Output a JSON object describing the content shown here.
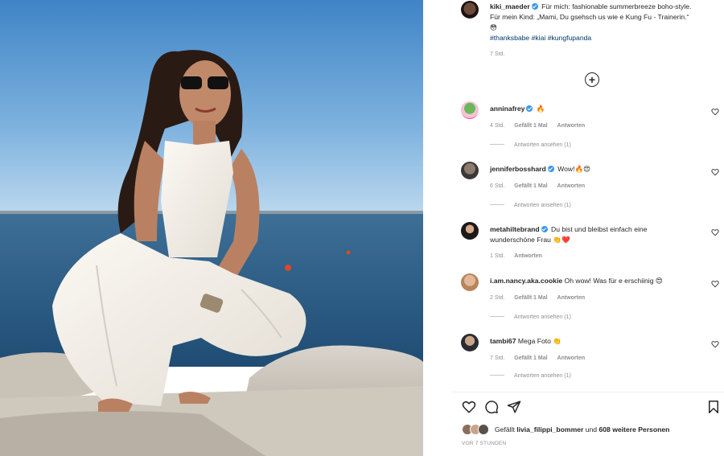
{
  "post": {
    "author": "kiki_maeder",
    "caption_line1": "Für mich: fashionable summerbreeze boho-style.",
    "caption_line2": "Für mein Kind: „Mami, Du gsehsch us wie e Kung Fu - Trainerin.“",
    "caption_emoji": "😳",
    "hashtags": [
      "#thanksbabe",
      "#kiai",
      "#kungfupanda"
    ],
    "time": "7 Std.",
    "verified": true
  },
  "comments": [
    {
      "user": "anninafrey",
      "verified": true,
      "text": "🔥",
      "time": "4 Std.",
      "likes": "Gefällt 1 Mal",
      "reply": "Antworten",
      "replies": "Antworten ansehen (1)"
    },
    {
      "user": "jenniferbosshard",
      "verified": true,
      "text": "Wow!🔥😍",
      "time": "6 Std.",
      "likes": "Gefällt 1 Mal",
      "reply": "Antworten",
      "replies": "Antworten ansehen (1)"
    },
    {
      "user": "metahiltebrand",
      "verified": true,
      "text": "Du bist und bleibst einfach eine wunderschöne Frau 👏❤️",
      "time": "1 Std.",
      "likes": "",
      "reply": "Antworten",
      "replies": ""
    },
    {
      "user": "i.am.nancy.aka.cookie",
      "verified": false,
      "text": "Oh wow! Was für e erschiinig 😍",
      "time": "2 Std.",
      "likes": "Gefällt 1 Mal",
      "reply": "Antworten",
      "replies": "Antworten ansehen (1)"
    },
    {
      "user": "tambi67",
      "verified": false,
      "text": "Mega Foto 👏",
      "time": "7 Std.",
      "likes": "Gefällt 1 Mal",
      "reply": "Antworten",
      "replies": "Antworten ansehen (1)"
    }
  ],
  "likes": {
    "prefix": "Gefällt",
    "user": "livia_filippi_bommer",
    "joiner": "und",
    "others": "608 weitere Personen"
  },
  "post_time": "VOR 7 STUNDEN",
  "load_more_symbol": "+",
  "icons": {
    "like": "heart-icon",
    "comment": "comment-icon",
    "share": "share-icon",
    "save": "bookmark-icon",
    "load_more": "plus-circle-icon"
  },
  "colors": {
    "verified": "#3897f0",
    "hashtag": "#00376b",
    "muted": "#8e8e8e",
    "text": "#262626"
  }
}
